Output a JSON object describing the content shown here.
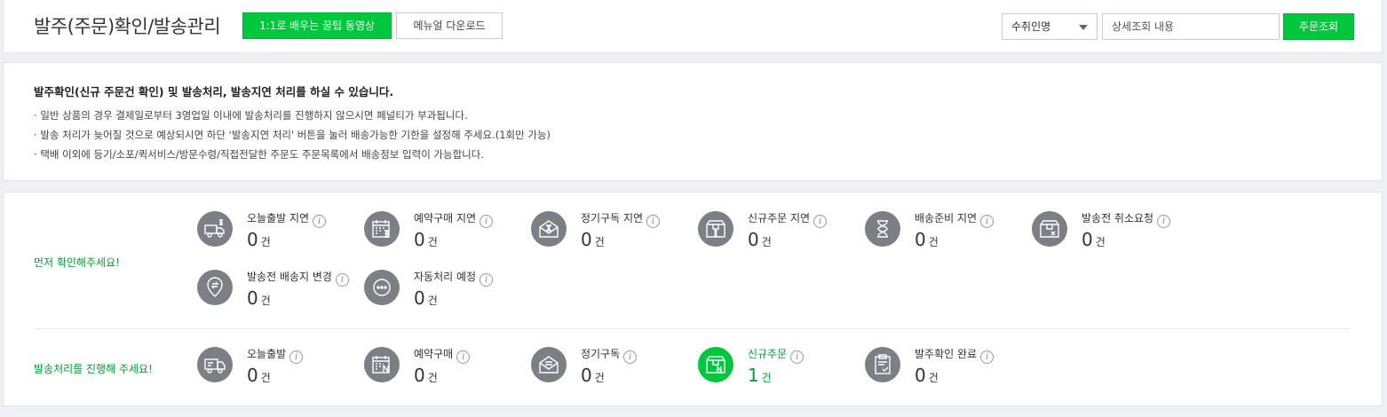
{
  "header": {
    "title": "발주(주문)확인/발송관리",
    "video_button": "1:1로 배우는 꿀팁 동영상",
    "manual_button": "메뉴얼 다운로드",
    "search_type": "수취인명",
    "search_placeholder": "상세조회 내용",
    "search_button": "주문조회"
  },
  "notice": {
    "title": "발주확인(신규 주문건 확인) 및 발송처리, 발송지연 처리를 하실 수 있습니다.",
    "items": [
      "일반 상품의 경우 결제일로부터 3영업일 이내에 발송처리를 진행하지 않으시면 페널티가 부과됩니다.",
      "발송 처리가 늦어질 것으로 예상되시면 하단 '발송지연 처리' 버튼을 눌러 배송가능한 기한을 설정해 주세요.(1회만 가능)",
      "택배 이외에 등기/소포/퀵서비스/방문수령/직접전달한 주문도 주문목록에서 배송정보 입력이 가능합니다."
    ]
  },
  "stats": {
    "info_glyph": "i",
    "unit": "건",
    "check_first": {
      "label": "먼저 확인해주세요!",
      "items": [
        {
          "label": "오늘출발 지연",
          "count": "0",
          "icon": "truck-hourglass-icon"
        },
        {
          "label": "예약구매 지연",
          "count": "0",
          "icon": "calendar-hourglass-icon"
        },
        {
          "label": "정기구독 지연",
          "count": "0",
          "icon": "envelope-hourglass-icon"
        },
        {
          "label": "신규주문 지연",
          "count": "0",
          "icon": "box-hourglass-icon"
        },
        {
          "label": "배송준비 지연",
          "count": "0",
          "icon": "hourglass-icon"
        },
        {
          "label": "발송전 취소요청",
          "count": "0",
          "icon": "box-cancel-icon"
        },
        {
          "label": "발송전 배송지 변경",
          "count": "0",
          "icon": "location-change-icon"
        },
        {
          "label": "자동처리 예정",
          "count": "0",
          "icon": "more-icon"
        }
      ]
    },
    "proceed": {
      "label": "발송처리를 진행해 주세요!",
      "items": [
        {
          "label": "오늘출발",
          "count": "0",
          "icon": "truck-icon"
        },
        {
          "label": "예약구매",
          "count": "0",
          "icon": "calendar-n-icon"
        },
        {
          "label": "정기구독",
          "count": "0",
          "icon": "envelope-icon"
        },
        {
          "label": "신규주문",
          "count": "1",
          "icon": "box-new-icon"
        },
        {
          "label": "발주확인 완료",
          "count": "0",
          "icon": "clipboard-check-icon"
        }
      ]
    }
  },
  "colors": {
    "accent": "#00c73c",
    "accent_text": "#00a032",
    "icon_bg": "#7c7f86"
  }
}
